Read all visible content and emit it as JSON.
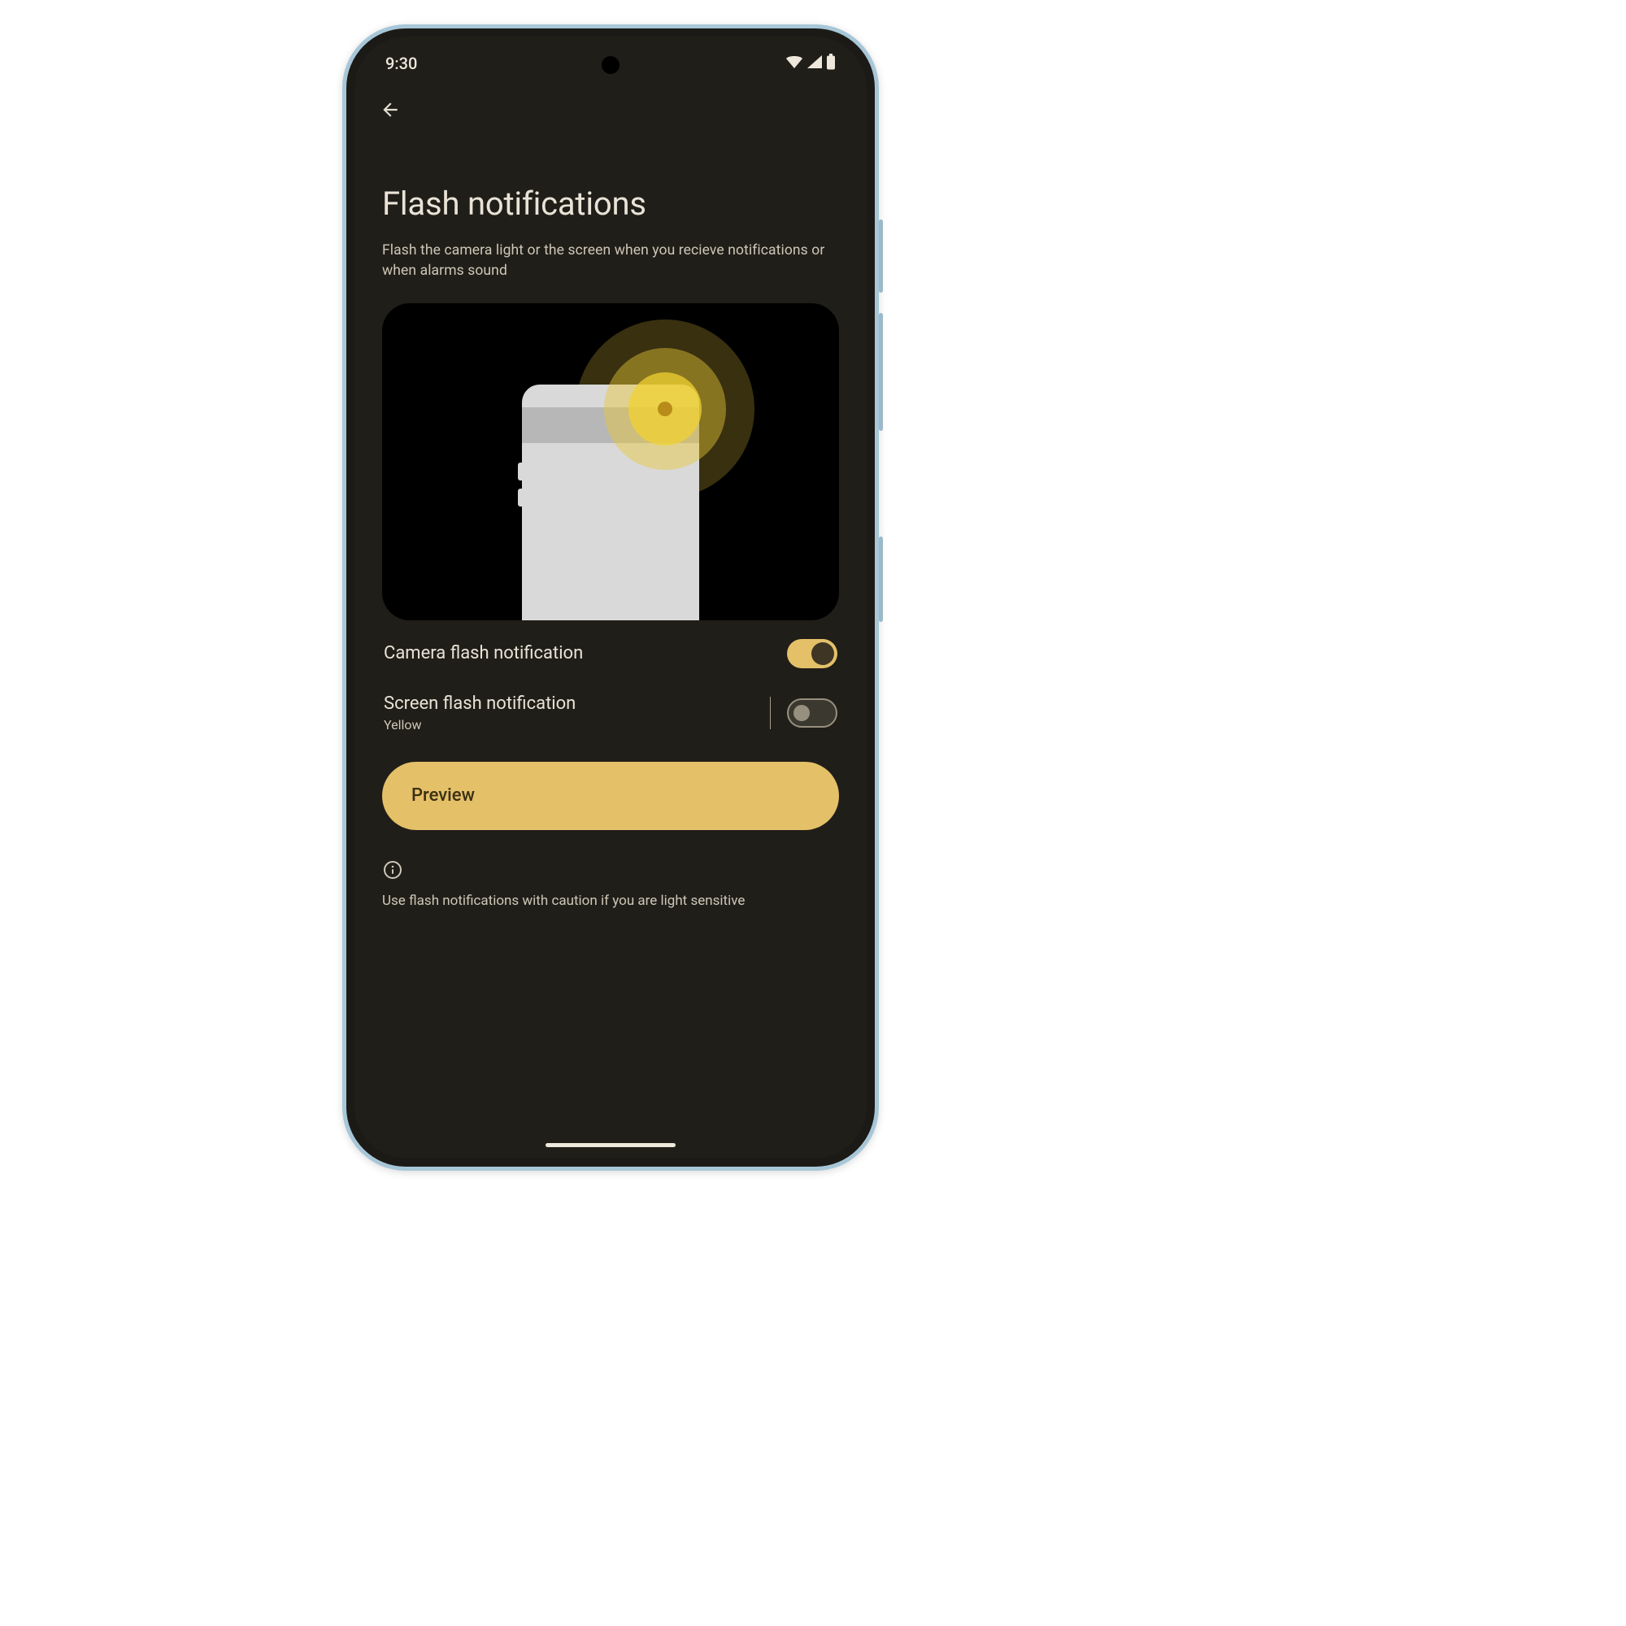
{
  "status": {
    "time": "9:30"
  },
  "page": {
    "title": "Flash notifications",
    "subtitle": "Flash the camera light or the screen when you recieve notifications or when alarms sound"
  },
  "settings": {
    "camera_flash": {
      "label": "Camera flash notification",
      "on": true
    },
    "screen_flash": {
      "label": "Screen flash notification",
      "value": "Yellow",
      "on": false
    }
  },
  "preview": {
    "label": "Preview"
  },
  "caution": {
    "text": "Use flash notifications with caution if you are light sensitive"
  },
  "colors": {
    "accent": "#e4c069",
    "bg": "#201e18",
    "text": "#e9e3d7",
    "muted": "#cec7b8"
  }
}
